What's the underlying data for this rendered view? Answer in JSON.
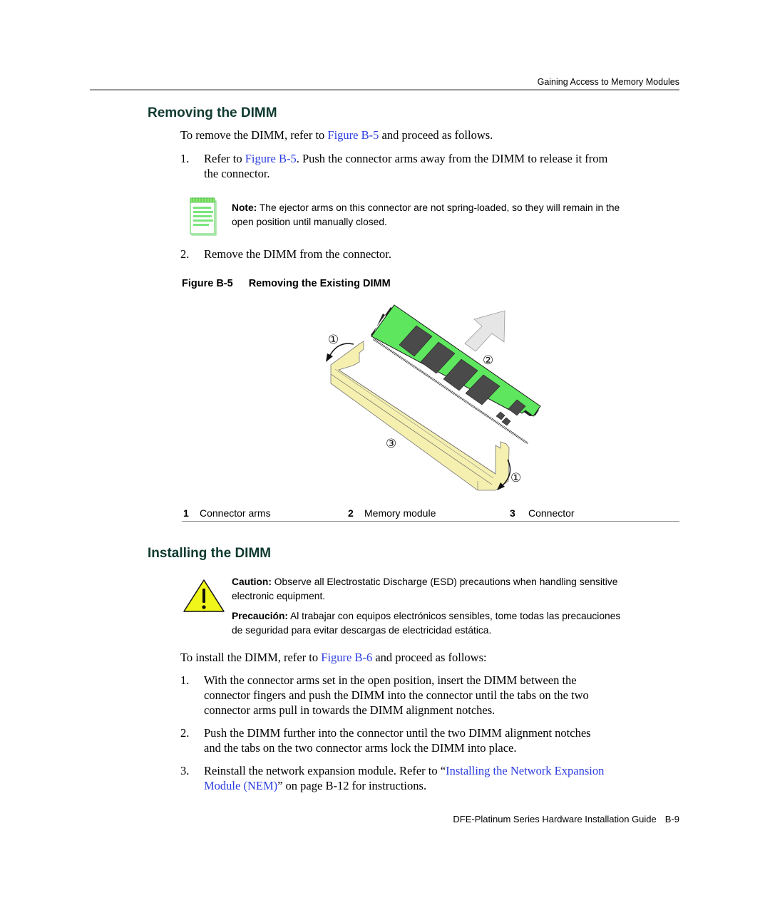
{
  "header": {
    "running_title": "Gaining Access to Memory Modules"
  },
  "removing": {
    "heading": "Removing the DIMM",
    "intro_before": "To remove the DIMM, refer to ",
    "intro_link": "Figure B-5",
    "intro_after": " and proceed as follows.",
    "steps": [
      {
        "number": "1.",
        "before": "Refer to ",
        "link": "Figure B-5",
        "after_line1": ". Push the connector arms away from the DIMM to release it from",
        "after_line2": "the connector."
      },
      {
        "number": "2.",
        "text": "Remove the DIMM from the connector."
      }
    ],
    "note": {
      "icon": "notepad-icon",
      "label": "Note:",
      "line1": " The ejector arms on this connector are not spring-loaded, so they will remain in the",
      "line2": "open position until manually closed."
    },
    "figure": {
      "number": "Figure B-5",
      "title": "Removing the Existing DIMM",
      "callouts": [
        "①",
        "②",
        "③",
        "①"
      ],
      "legend": [
        {
          "number": "1",
          "label": "Connector arms"
        },
        {
          "number": "2",
          "label": "Memory module"
        },
        {
          "number": "3",
          "label": "Connector"
        }
      ],
      "colors": {
        "module": "#5ee65e",
        "connector": "#f5f0b0",
        "arrow": "#e6e6e6",
        "chip": "#4a4a4a"
      }
    }
  },
  "installing": {
    "heading": "Installing the DIMM",
    "caution": {
      "icon": "warning-triangle-icon",
      "label": "Caution:",
      "line1": " Observe all Electrostatic Discharge (ESD) precautions when handling sensitive",
      "line2": "electronic equipment.",
      "es_label": "Precaución:",
      "es_line1": " Al trabajar con equipos electrónicos sensibles, tome todas las precauciones",
      "es_line2": "de seguridad para evitar descargas  de electricidad estática."
    },
    "intro_before": "To install the DIMM, refer to ",
    "intro_link": "Figure B-6",
    "intro_after": " and proceed as follows:",
    "steps": [
      {
        "number": "1.",
        "lines": [
          "With the connector arms set in the open position, insert the DIMM between the",
          "connector fingers and push the DIMM into the connector until the tabs on the two",
          "connector arms pull in towards the DIMM alignment notches."
        ]
      },
      {
        "number": "2.",
        "lines": [
          "Push the DIMM further into the connector until the two DIMM alignment notches",
          "and the tabs on the two connector arms lock the DIMM into place."
        ]
      },
      {
        "number": "3.",
        "before": "Reinstall the network expansion module. Refer to “",
        "link_line1": "Installing the Network Expansion",
        "link_line2": "Module (NEM)",
        "after": "” on page B-12 for instructions."
      }
    ]
  },
  "footer": {
    "guide_title": "DFE-Platinum Series Hardware Installation Guide",
    "page": "B-9"
  },
  "colors": {
    "heading": "#0f3a30",
    "link": "#2b3de0",
    "rule": "#999999"
  }
}
